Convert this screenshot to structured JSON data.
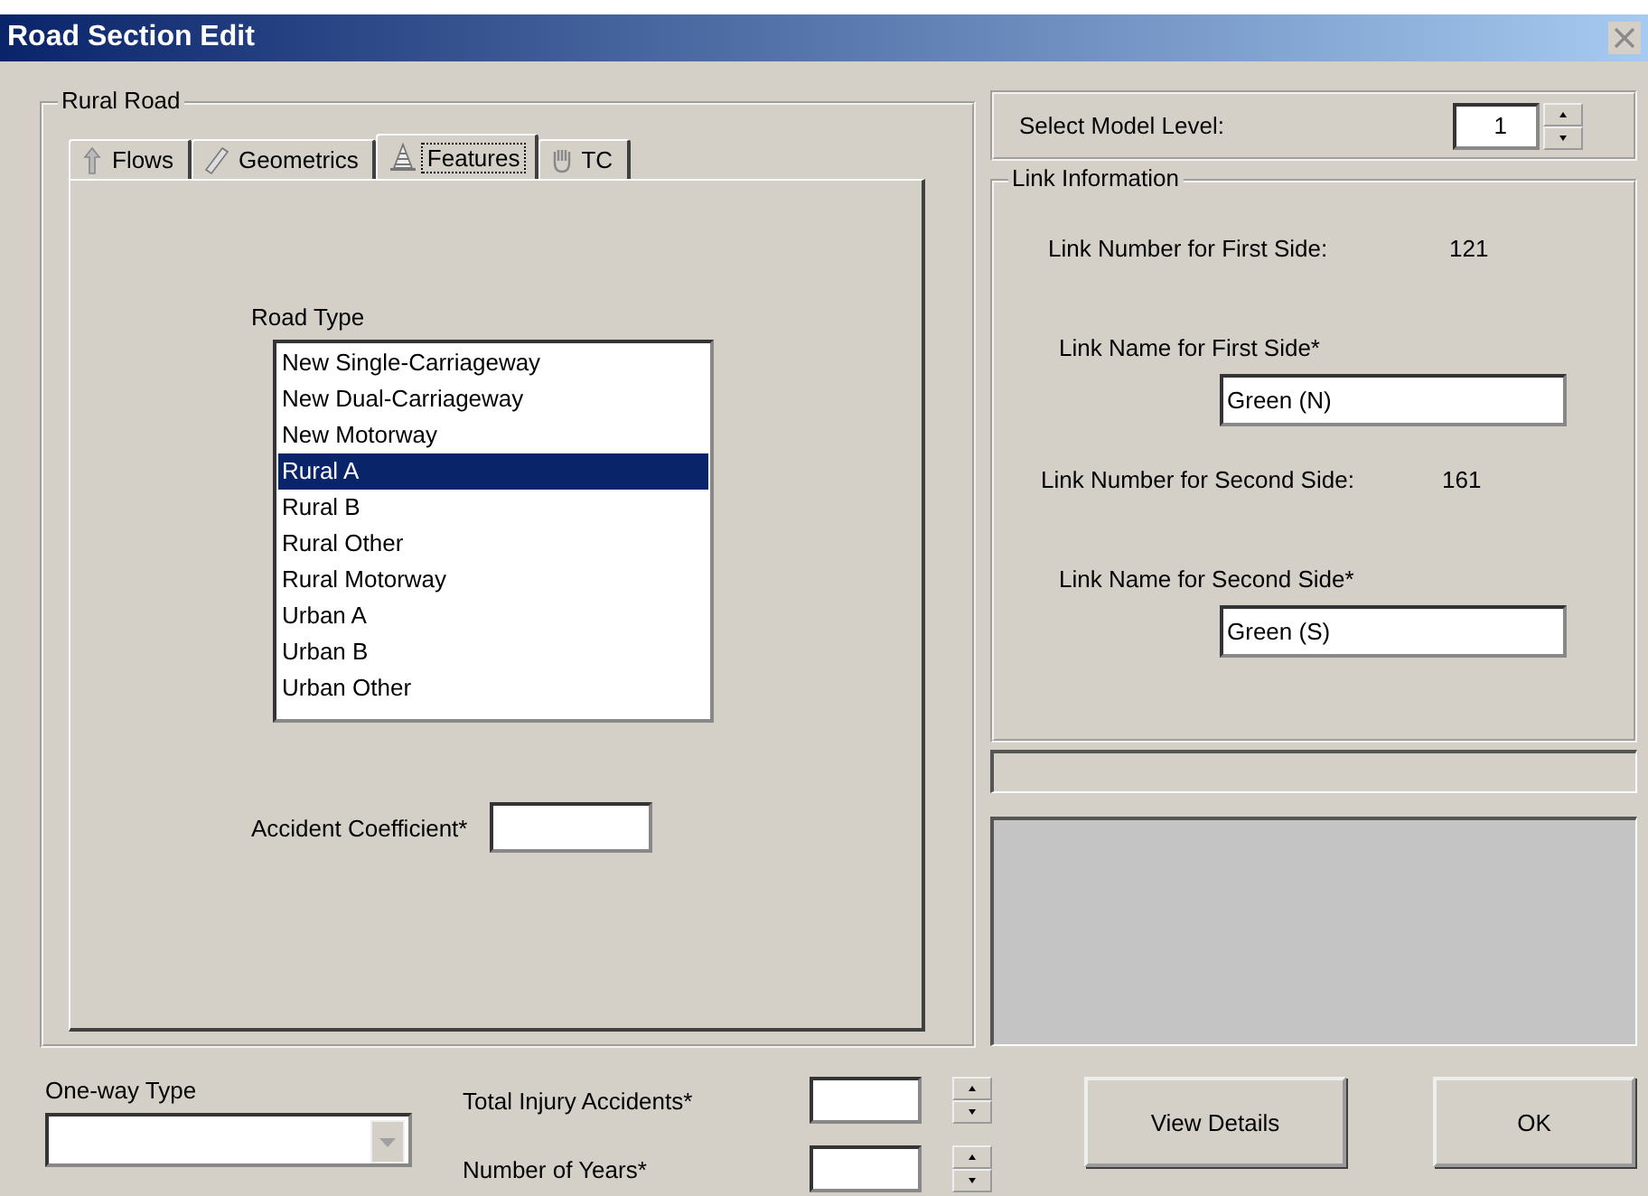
{
  "window": {
    "title": "Road Section Edit"
  },
  "road_group": {
    "title": "Rural Road"
  },
  "tabs": [
    {
      "label": "Flows",
      "selected": false
    },
    {
      "label": "Geometrics",
      "selected": false
    },
    {
      "label": "Features",
      "selected": true
    },
    {
      "label": "TC",
      "selected": false
    }
  ],
  "road_type": {
    "label": "Road Type",
    "items": [
      {
        "label": "New Single-Carriageway",
        "selected": false
      },
      {
        "label": "New Dual-Carriageway",
        "selected": false
      },
      {
        "label": "New Motorway",
        "selected": false
      },
      {
        "label": "Rural A",
        "selected": true
      },
      {
        "label": "Rural B",
        "selected": false
      },
      {
        "label": "Rural Other",
        "selected": false
      },
      {
        "label": "Rural Motorway",
        "selected": false
      },
      {
        "label": "Urban A",
        "selected": false
      },
      {
        "label": "Urban B",
        "selected": false
      },
      {
        "label": "Urban Other",
        "selected": false
      }
    ]
  },
  "accident_coefficient": {
    "label": "Accident Coefficient*"
  },
  "model_level": {
    "label": "Select Model Level:",
    "value": "1"
  },
  "link_information": {
    "title": "Link Information",
    "rows": [
      {
        "kind": "number",
        "label": "Link Number for First Side:",
        "value": "121"
      },
      {
        "kind": "name",
        "label": "Link Name for First Side*",
        "value": "Green (N)"
      },
      {
        "kind": "number",
        "label": "Link Number for Second Side:",
        "value": "161"
      },
      {
        "kind": "name",
        "label": "Link Name for Second Side*",
        "value": "Green (S)"
      }
    ]
  },
  "one_way_type": {
    "label": "One-way Type",
    "disabled": true
  },
  "total_injury_accidents": {
    "label": "Total Injury Accidents*"
  },
  "number_of_years": {
    "label": "Number of Years*"
  },
  "buttons": [
    "View Details",
    "OK"
  ]
}
